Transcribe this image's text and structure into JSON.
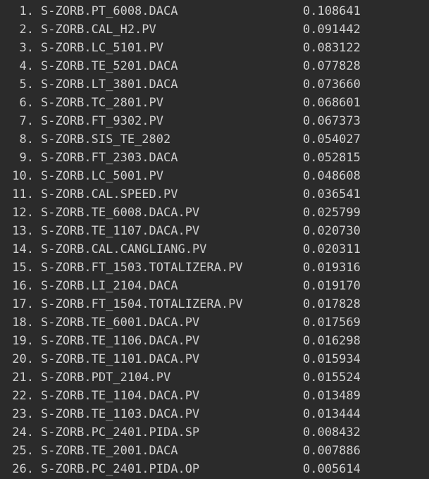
{
  "output": {
    "rows": [
      {
        "index": "1.",
        "name": "S-ZORB.PT_6008.DACA",
        "value": "0.108641"
      },
      {
        "index": "2.",
        "name": "S-ZORB.CAL_H2.PV",
        "value": "0.091442"
      },
      {
        "index": "3.",
        "name": "S-ZORB.LC_5101.PV",
        "value": "0.083122"
      },
      {
        "index": "4.",
        "name": "S-ZORB.TE_5201.DACA",
        "value": "0.077828"
      },
      {
        "index": "5.",
        "name": "S-ZORB.LT_3801.DACA",
        "value": "0.073660"
      },
      {
        "index": "6.",
        "name": "S-ZORB.TC_2801.PV",
        "value": "0.068601"
      },
      {
        "index": "7.",
        "name": "S-ZORB.FT_9302.PV",
        "value": "0.067373"
      },
      {
        "index": "8.",
        "name": "S-ZORB.SIS_TE_2802",
        "value": "0.054027"
      },
      {
        "index": "9.",
        "name": "S-ZORB.FT_2303.DACA",
        "value": "0.052815"
      },
      {
        "index": "10.",
        "name": "S-ZORB.LC_5001.PV",
        "value": "0.048608"
      },
      {
        "index": "11.",
        "name": "S-ZORB.CAL.SPEED.PV",
        "value": "0.036541"
      },
      {
        "index": "12.",
        "name": "S-ZORB.TE_6008.DACA.PV",
        "value": "0.025799"
      },
      {
        "index": "13.",
        "name": "S-ZORB.TE_1107.DACA.PV",
        "value": "0.020730"
      },
      {
        "index": "14.",
        "name": "S-ZORB.CAL.CANGLIANG.PV",
        "value": "0.020311"
      },
      {
        "index": "15.",
        "name": "S-ZORB.FT_1503.TOTALIZERA.PV",
        "value": "0.019316"
      },
      {
        "index": "16.",
        "name": "S-ZORB.LI_2104.DACA",
        "value": "0.019170"
      },
      {
        "index": "17.",
        "name": "S-ZORB.FT_1504.TOTALIZERA.PV",
        "value": "0.017828"
      },
      {
        "index": "18.",
        "name": "S-ZORB.TE_6001.DACA.PV",
        "value": "0.017569"
      },
      {
        "index": "19.",
        "name": "S-ZORB.TE_1106.DACA.PV",
        "value": "0.016298"
      },
      {
        "index": "20.",
        "name": "S-ZORB.TE_1101.DACA.PV",
        "value": "0.015934"
      },
      {
        "index": "21.",
        "name": "S-ZORB.PDT_2104.PV",
        "value": "0.015524"
      },
      {
        "index": "22.",
        "name": "S-ZORB.TE_1104.DACA.PV",
        "value": "0.013489"
      },
      {
        "index": "23.",
        "name": "S-ZORB.TE_1103.DACA.PV",
        "value": "0.013444"
      },
      {
        "index": "24.",
        "name": "S-ZORB.PC_2401.PIDA.SP",
        "value": "0.008432"
      },
      {
        "index": "25.",
        "name": "S-ZORB.TE_2001.DACA",
        "value": "0.007886"
      },
      {
        "index": "26.",
        "name": "S-ZORB.PC_2401.PIDA.OP",
        "value": "0.005614"
      }
    ]
  }
}
